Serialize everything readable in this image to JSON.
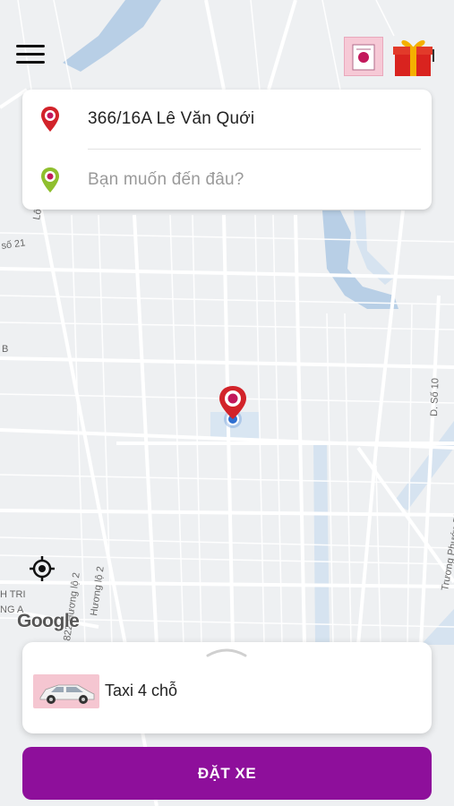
{
  "colors": {
    "accent": "#8e0f9b",
    "pickup_pin": "#d2232a",
    "destination_pin": "#8fbf2e",
    "water": "#b8cfe6"
  },
  "header": {
    "menu_icon": "hamburger-menu-icon",
    "promo_icon": "promo-voucher-icon",
    "gift_icon": "gift-box-icon"
  },
  "route": {
    "pickup": {
      "address": "366/16A Lê Văn Quới",
      "icon": "red-pin-icon"
    },
    "destination": {
      "placeholder": "Bạn muốn đến đâu?",
      "icon": "green-pin-icon"
    }
  },
  "map": {
    "street_labels": [
      "Lô",
      "số 21",
      "B",
      "D. Số 10",
      "Trương Phước Phan",
      "Hương lộ 2",
      "822 Hương lộ 2",
      "H TRI",
      "NG A"
    ],
    "watermark": "Google"
  },
  "vehicles": {
    "selected": {
      "label": "Taxi 4 chỗ"
    }
  },
  "actions": {
    "book_label": "ĐẶT XE"
  }
}
